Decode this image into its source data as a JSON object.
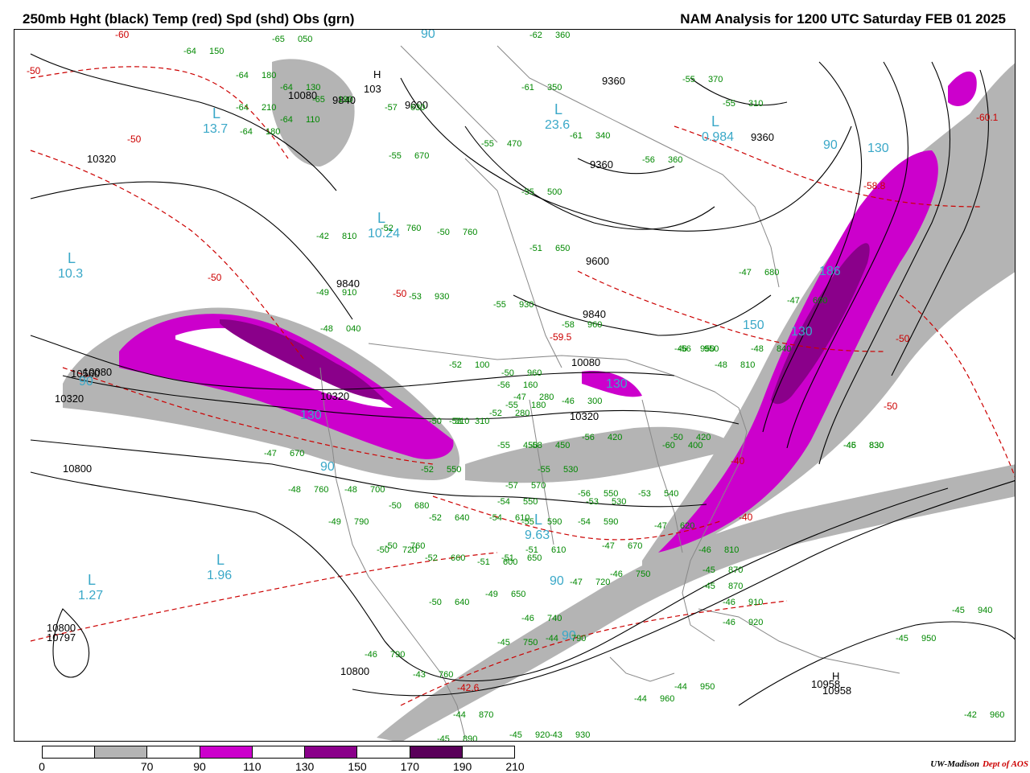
{
  "header": {
    "left_title": "250mb Hght (black) Temp (red) Spd (shd) Obs (grn)",
    "right_title": "NAM Analysis for 1200 UTC Saturday  FEB 01 2025"
  },
  "colors": {
    "height_contour": "#000000",
    "temperature_contour": "#cc0000",
    "observations": "#008800",
    "centers_label": "#3aa8c8",
    "speed_70_90": "#b4b4b4",
    "speed_110_130": "#cc00cc",
    "speed_150_170": "#8a008a",
    "speed_190_210": "#5a005a",
    "boundaries": "#888888"
  },
  "colorbar": {
    "ticks": [
      "0",
      "70",
      "90",
      "110",
      "130",
      "150",
      "170",
      "190",
      "210"
    ],
    "segments": [
      "#ffffff",
      "#b4b4b4",
      "#ffffff",
      "#cc00cc",
      "#ffffff",
      "#8a008a",
      "#ffffff",
      "#5a005a",
      "#ffffff"
    ]
  },
  "height_labels": [
    "10080",
    "9840",
    "9600",
    "9360",
    "9360",
    "9360",
    "10320",
    "9600",
    "9840",
    "9840",
    "10080",
    "10080",
    "10320",
    "10320",
    "10560",
    "10800",
    "10800",
    "10800",
    "10797",
    "10958",
    "10320"
  ],
  "temp_labels": [
    "-60",
    "-50",
    "-50",
    "-50",
    "-50",
    "-50",
    "-59.5",
    "-58.8",
    "-60.1",
    "-42.6",
    "-40",
    "-50",
    "-40"
  ],
  "speed_labels": [
    "90",
    "90",
    "90",
    "90",
    "130",
    "130",
    "130",
    "186",
    "130",
    "150",
    "90",
    "90"
  ],
  "centers": [
    {
      "type": "L",
      "value": "13.7"
    },
    {
      "type": "L",
      "value": "10.3"
    },
    {
      "type": "H",
      "value": "103"
    },
    {
      "type": "L",
      "value": "23.6"
    },
    {
      "type": "L",
      "value": "0.984"
    },
    {
      "type": "L",
      "value": "10.24"
    },
    {
      "type": "L",
      "value": "1.96"
    },
    {
      "type": "L",
      "value": "1.27"
    },
    {
      "type": "L",
      "value": "9.63"
    },
    {
      "type": "H",
      "value": "10958"
    }
  ],
  "observations": [
    "-64 150",
    "-64 180",
    "-64 130",
    "-65 190",
    "-64 210",
    "-64 110",
    "-64 180",
    "-65 050",
    "-57 630",
    "-55 670",
    "-55 470",
    "-61 350",
    "-62 360",
    "-61 340",
    "-56 360",
    "-55 500",
    "-51 650",
    "-55 930",
    "-53 930",
    "-50 760",
    "-52 760",
    "-46 830",
    "-42 810",
    "-49 910",
    "-48 040",
    "-52 100",
    "-56 160",
    "-55 180",
    "-47 280",
    "-46 300",
    "-52 280",
    "-53 310",
    "-55 450",
    "-58 450",
    "-56 420",
    "-60 400",
    "-53 540",
    "-55 530",
    "-57 570",
    "-56 550",
    "-52 640",
    "-54 610",
    "-55 590",
    "-54 590",
    "-51 610",
    "-51 600",
    "-52 660",
    "-50 640",
    "-49 650",
    "-46 740",
    "-44 790",
    "-45 750",
    "-47 720",
    "-46 750",
    "-47 670",
    "-47 620",
    "-46 810",
    "-45 870",
    "-45 870",
    "-46 910",
    "-46 920",
    "-45 950",
    "-45 940",
    "-44 950",
    "-44 960",
    "-42 960",
    "-44 870",
    "-45 890",
    "-45 920",
    "-43 930",
    "-43 760",
    "-46 790",
    "-50 720",
    "-49 790",
    "-48 760",
    "-48 700",
    "-50 680",
    "-47 670",
    "-52 550",
    "-50 310",
    "-54 550",
    "-51 650",
    "-53 530",
    "-50 420",
    "-47 690",
    "-46 950",
    "-48 810",
    "-45 830",
    "-47 680",
    "-48 840",
    "-50 760",
    "-56 950",
    "-58 960",
    "-50 960",
    "-55 370",
    "-55 310"
  ],
  "credit": {
    "institution": "UW-Madison",
    "dept": "Dept of AOS"
  }
}
